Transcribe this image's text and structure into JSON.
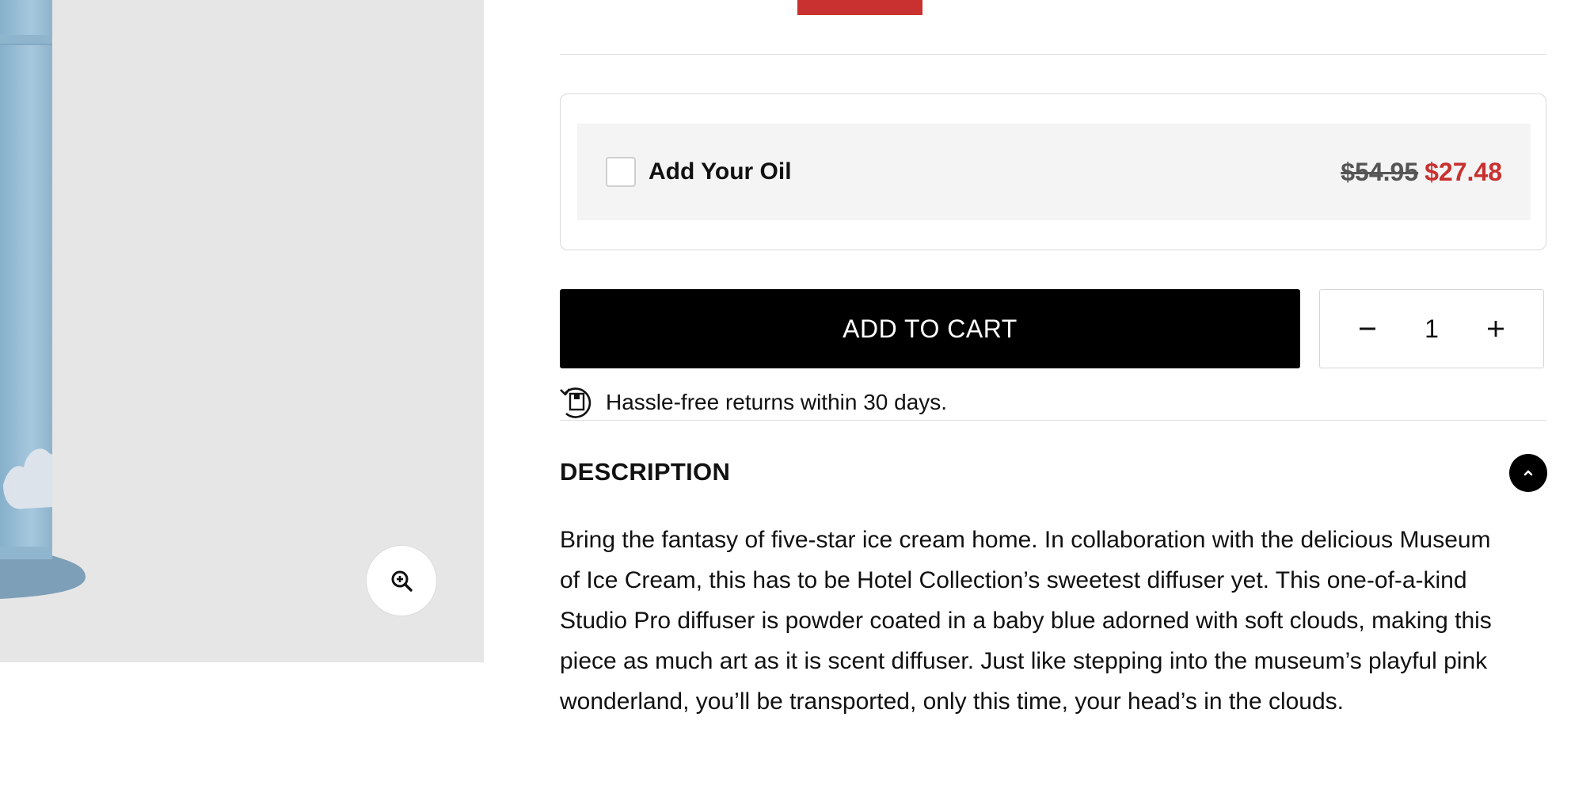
{
  "addon": {
    "label": "Add Your Oil",
    "price_original": "$54.95",
    "price_sale": "$27.48",
    "checked": false
  },
  "cart": {
    "button_label": "ADD TO CART",
    "quantity": "1",
    "decrement_symbol": "−",
    "increment_symbol": "+"
  },
  "returns": {
    "text": "Hassle-free returns within 30 days.",
    "icon": "returns-box-icon"
  },
  "description": {
    "title": "DESCRIPTION",
    "body": "Bring the fantasy of five-star ice cream home. In collaboration with the delicious Museum of Ice Cream, this has to be Hotel Collection’s sweetest diffuser yet. This one-of-a-kind Studio Pro diffuser is powder coated in a baby blue adorned with soft clouds, making this piece as much art as it is scent diffuser. Just like stepping into the museum’s playful pink wonderland, you’ll be transported, only this time, your head’s in the clouds.",
    "expanded": true
  },
  "colors": {
    "sale_red": "#c8312f",
    "button_black": "#000000",
    "product_blue": "#9fc3d9",
    "panel_gray": "#e6e6e6"
  }
}
